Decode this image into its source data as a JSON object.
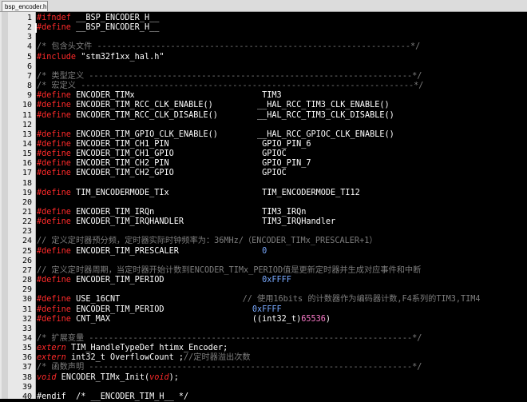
{
  "tab": {
    "label": "bsp_encoder.h"
  },
  "lines": [
    {
      "n": "1",
      "parts": [
        [
          "pp",
          "#ifndef"
        ],
        [
          "tx",
          " __BSP_ENCODER_H__"
        ]
      ]
    },
    {
      "n": "2",
      "parts": [
        [
          "pp",
          "#define"
        ],
        [
          "tx",
          " __BSP_ENCODER_H__"
        ]
      ]
    },
    {
      "n": "3",
      "parts": []
    },
    {
      "n": "4",
      "parts": [
        [
          "cm",
          "/* 包含头文件 ----------------------------------------------------------------*/"
        ]
      ]
    },
    {
      "n": "5",
      "parts": [
        [
          "pp",
          "#include"
        ],
        [
          "tx",
          " \"stm32f1xx_hal.h\""
        ]
      ]
    },
    {
      "n": "6",
      "parts": []
    },
    {
      "n": "7",
      "parts": [
        [
          "cm",
          "/* 类型定义 ------------------------------------------------------------------*/"
        ]
      ]
    },
    {
      "n": "8",
      "parts": [
        [
          "cm",
          "/* 宏定义 --------------------------------------------------------------------*/"
        ]
      ]
    },
    {
      "n": "9",
      "parts": [
        [
          "pp",
          "#define"
        ],
        [
          "tx",
          " ENCODER_TIMx                          TIM3"
        ]
      ]
    },
    {
      "n": "10",
      "parts": [
        [
          "pp",
          "#define"
        ],
        [
          "tx",
          " ENCODER_TIM_RCC_CLK_ENABLE()         __HAL_RCC_TIM3_CLK_ENABLE()"
        ]
      ]
    },
    {
      "n": "11",
      "parts": [
        [
          "pp",
          "#define"
        ],
        [
          "tx",
          " ENCODER_TIM_RCC_CLK_DISABLE()        __HAL_RCC_TIM3_CLK_DISABLE()"
        ]
      ]
    },
    {
      "n": "12",
      "parts": []
    },
    {
      "n": "13",
      "parts": [
        [
          "pp",
          "#define"
        ],
        [
          "tx",
          " ENCODER_TIM_GPIO_CLK_ENABLE()        __HAL_RCC_GPIOC_CLK_ENABLE()"
        ]
      ]
    },
    {
      "n": "14",
      "parts": [
        [
          "pp",
          "#define"
        ],
        [
          "tx",
          " ENCODER_TIM_CH1_PIN                   GPIO_PIN_6"
        ]
      ]
    },
    {
      "n": "15",
      "parts": [
        [
          "pp",
          "#define"
        ],
        [
          "tx",
          " ENCODER_TIM_CH1_GPIO                  GPIOC"
        ]
      ]
    },
    {
      "n": "16",
      "parts": [
        [
          "pp",
          "#define"
        ],
        [
          "tx",
          " ENCODER_TIM_CH2_PIN                   GPIO_PIN_7"
        ]
      ]
    },
    {
      "n": "17",
      "parts": [
        [
          "pp",
          "#define"
        ],
        [
          "tx",
          " ENCODER_TIM_CH2_GPIO                  GPIOC"
        ]
      ]
    },
    {
      "n": "18",
      "parts": []
    },
    {
      "n": "19",
      "parts": [
        [
          "pp",
          "#define"
        ],
        [
          "tx",
          " TIM_ENCODERMODE_TIx                   TIM_ENCODERMODE_TI12"
        ]
      ]
    },
    {
      "n": "20",
      "parts": []
    },
    {
      "n": "21",
      "parts": [
        [
          "pp",
          "#define"
        ],
        [
          "tx",
          " ENCODER_TIM_IRQn                      TIM3_IRQn"
        ]
      ]
    },
    {
      "n": "22",
      "parts": [
        [
          "pp",
          "#define"
        ],
        [
          "tx",
          " ENCODER_TIM_IRQHANDLER                TIM3_IRQHandler"
        ]
      ]
    },
    {
      "n": "23",
      "parts": []
    },
    {
      "n": "24",
      "parts": [
        [
          "cm",
          "// 定义定时器预分频，定时器实际时钟频率为：36MHz/（ENCODER_TIMx_PRESCALER+1）"
        ]
      ]
    },
    {
      "n": "25",
      "parts": [
        [
          "pp",
          "#define"
        ],
        [
          "tx",
          " ENCODER_TIM_PRESCALER                 "
        ],
        [
          "hx",
          "0"
        ]
      ]
    },
    {
      "n": "26",
      "parts": []
    },
    {
      "n": "27",
      "parts": [
        [
          "cm",
          "// 定义定时器周期，当定时器开始计数到ENCODER_TIMx_PERIOD值是更新定时器并生成对应事件和中断"
        ]
      ]
    },
    {
      "n": "28",
      "parts": [
        [
          "pp",
          "#define"
        ],
        [
          "tx",
          " ENCODER_TIM_PERIOD                    "
        ],
        [
          "hx",
          "0xFFFF"
        ]
      ]
    },
    {
      "n": "29",
      "parts": []
    },
    {
      "n": "30",
      "parts": [
        [
          "pp",
          "#define"
        ],
        [
          "tx",
          " USE_16CNT                         "
        ],
        [
          "cm",
          "// 使用16bits 的计数器作为编码器计数,F4系列的TIM3,TIM4"
        ]
      ]
    },
    {
      "n": "31",
      "parts": [
        [
          "pp",
          "#define"
        ],
        [
          "tx",
          " ENCODER_TIM_PERIOD                  "
        ],
        [
          "hx",
          "0xFFFF"
        ]
      ]
    },
    {
      "n": "32",
      "parts": [
        [
          "pp",
          "#define"
        ],
        [
          "tx",
          " CNT_MAX                             ((int32_t)"
        ],
        [
          "ic",
          "65536"
        ],
        [
          "tx",
          ")"
        ]
      ]
    },
    {
      "n": "33",
      "parts": []
    },
    {
      "n": "34",
      "parts": [
        [
          "cm",
          "/* 扩展变量 ------------------------------------------------------------------*/"
        ]
      ]
    },
    {
      "n": "35",
      "parts": [
        [
          "kw",
          "extern"
        ],
        [
          "tx",
          " TIM_HandleTypeDef htimx_Encoder;"
        ]
      ]
    },
    {
      "n": "36",
      "parts": [
        [
          "kw",
          "extern"
        ],
        [
          "tx",
          " int32_t OverflowCount ;"
        ],
        [
          "cm",
          "//定时器溢出次数"
        ]
      ]
    },
    {
      "n": "37",
      "parts": [
        [
          "cm",
          "/* 函数声明 ------------------------------------------------------------------*/"
        ]
      ]
    },
    {
      "n": "38",
      "parts": [
        [
          "kw",
          "void"
        ],
        [
          "tx",
          " ENCODER_TIMx_Init("
        ],
        [
          "kw",
          "void"
        ],
        [
          "tx",
          ");"
        ]
      ]
    },
    {
      "n": "39",
      "parts": []
    },
    {
      "n": "40",
      "parts": [
        [
          "tx",
          "#endif  /* __ENCODER_TIM_H__ */"
        ]
      ]
    }
  ]
}
